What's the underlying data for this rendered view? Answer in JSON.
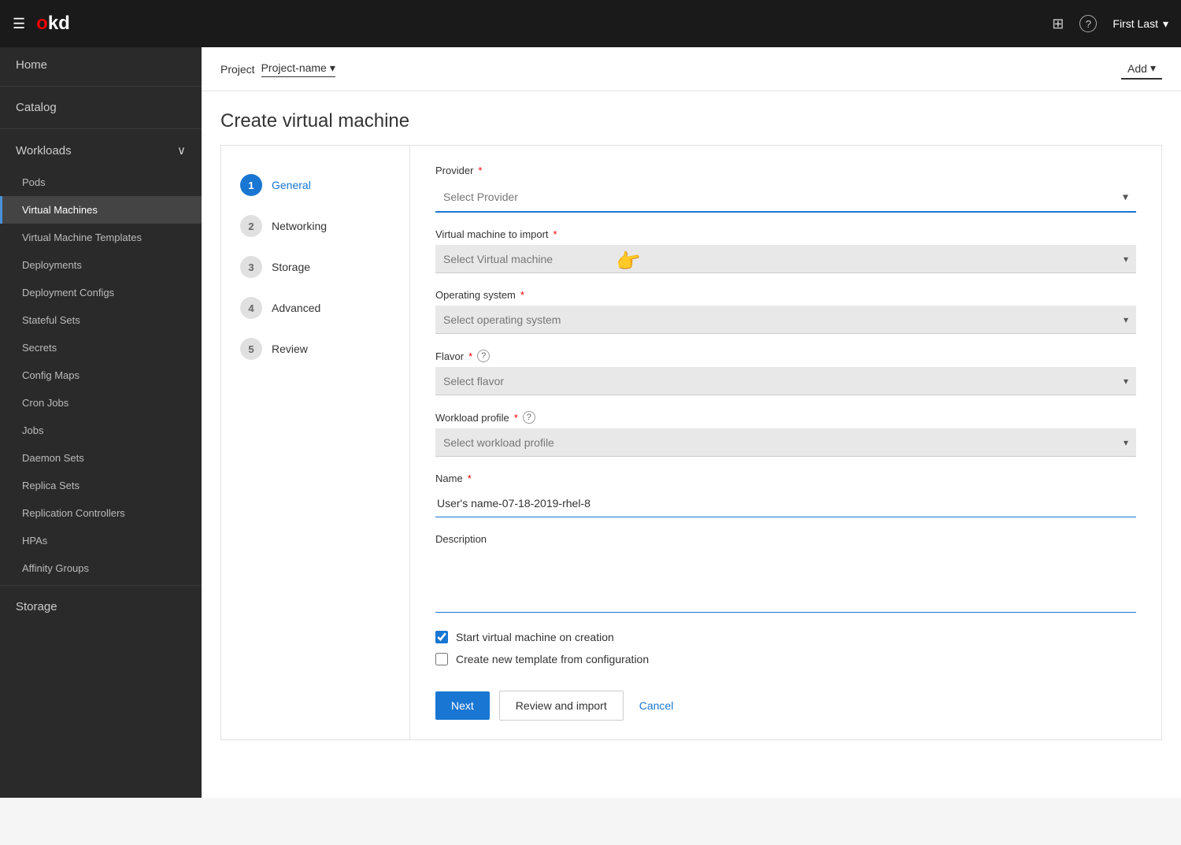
{
  "topnav": {
    "logo": "okd",
    "logo_o": "o",
    "logo_rest": "kd",
    "user_label": "First Last",
    "grid_icon": "⊞",
    "help_icon": "?",
    "chevron_icon": "▾"
  },
  "sidebar": {
    "home_label": "Home",
    "catalog_label": "Catalog",
    "workloads_label": "Workloads",
    "storage_label": "Storage",
    "items": [
      {
        "id": "pods",
        "label": "Pods"
      },
      {
        "id": "virtual-machines",
        "label": "Virtual Machines",
        "active": true
      },
      {
        "id": "virtual-machine-templates",
        "label": "Virtual Machine Templates"
      },
      {
        "id": "deployments",
        "label": "Deployments"
      },
      {
        "id": "deployment-configs",
        "label": "Deployment Configs"
      },
      {
        "id": "stateful-sets",
        "label": "Stateful Sets"
      },
      {
        "id": "secrets",
        "label": "Secrets"
      },
      {
        "id": "config-maps",
        "label": "Config Maps"
      },
      {
        "id": "cron-jobs",
        "label": "Cron Jobs"
      },
      {
        "id": "jobs",
        "label": "Jobs"
      },
      {
        "id": "daemon-sets",
        "label": "Daemon Sets"
      },
      {
        "id": "replica-sets",
        "label": "Replica Sets"
      },
      {
        "id": "replication-controllers",
        "label": "Replication Controllers"
      },
      {
        "id": "hpas",
        "label": "HPAs"
      },
      {
        "id": "affinity-groups",
        "label": "Affinity Groups"
      }
    ]
  },
  "subheader": {
    "project_label": "Project",
    "project_name": "Project-name",
    "add_label": "Add",
    "chevron": "▾"
  },
  "page": {
    "title": "Create virtual machine"
  },
  "wizard": {
    "steps": [
      {
        "number": "1",
        "label": "General",
        "active": true
      },
      {
        "number": "2",
        "label": "Networking",
        "active": false
      },
      {
        "number": "3",
        "label": "Storage",
        "active": false
      },
      {
        "number": "4",
        "label": "Advanced",
        "active": false
      },
      {
        "number": "5",
        "label": "Review",
        "active": false
      }
    ],
    "form": {
      "provider_label": "Provider",
      "provider_placeholder": "Select Provider",
      "vm_import_label": "Virtual machine to import",
      "vm_import_placeholder": "Select Virtual machine",
      "os_label": "Operating system",
      "os_placeholder": "Select operating system",
      "flavor_label": "Flavor",
      "flavor_placeholder": "Select flavor",
      "workload_label": "Workload profile",
      "workload_placeholder": "Select workload profile",
      "name_label": "Name",
      "name_value": "User's name-07-18-2019-rhel-8",
      "description_label": "Description",
      "description_value": "",
      "checkbox1_label": "Start virtual machine on creation",
      "checkbox1_checked": true,
      "checkbox2_label": "Create new template from configuration",
      "checkbox2_checked": false
    },
    "actions": {
      "next_label": "Next",
      "review_import_label": "Review and import",
      "cancel_label": "Cancel"
    }
  }
}
